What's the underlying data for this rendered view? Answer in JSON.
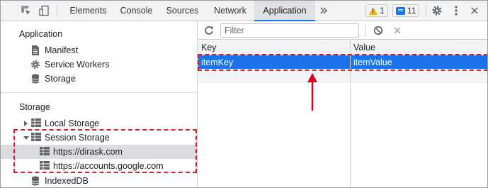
{
  "toolbar": {
    "tabs": [
      "Elements",
      "Console",
      "Sources",
      "Network",
      "Application"
    ],
    "active_tab": "Application",
    "more_tabs_icon": "double-chevron-right-icon",
    "warnings_count": "1",
    "messages_count": "11",
    "icons": [
      "inspect-element-icon",
      "device-toggle-icon",
      "warning-icon",
      "message-icon",
      "gear-icon",
      "more-vertical-icon"
    ]
  },
  "sidebar": {
    "application": {
      "title": "Application",
      "items": [
        "Manifest",
        "Service Workers",
        "Storage"
      ]
    },
    "storage": {
      "title": "Storage",
      "local_storage": "Local Storage",
      "session_storage": "Session Storage",
      "session_children": [
        "https://dirask.com",
        "https://accounts.google.com"
      ],
      "indexeddb": "IndexedDB"
    }
  },
  "storage_view": {
    "filter_placeholder": "Filter",
    "icons": [
      "refresh-icon",
      "clear-all-icon",
      "delete-icon"
    ],
    "columns": [
      "Key",
      "Value"
    ],
    "rows": [
      {
        "key": "itemKey",
        "value": "itemValue"
      }
    ]
  },
  "colors": {
    "accent": "#1a73e8",
    "highlight": "#d2202a",
    "toolbar_bg": "#f1f3f4"
  }
}
